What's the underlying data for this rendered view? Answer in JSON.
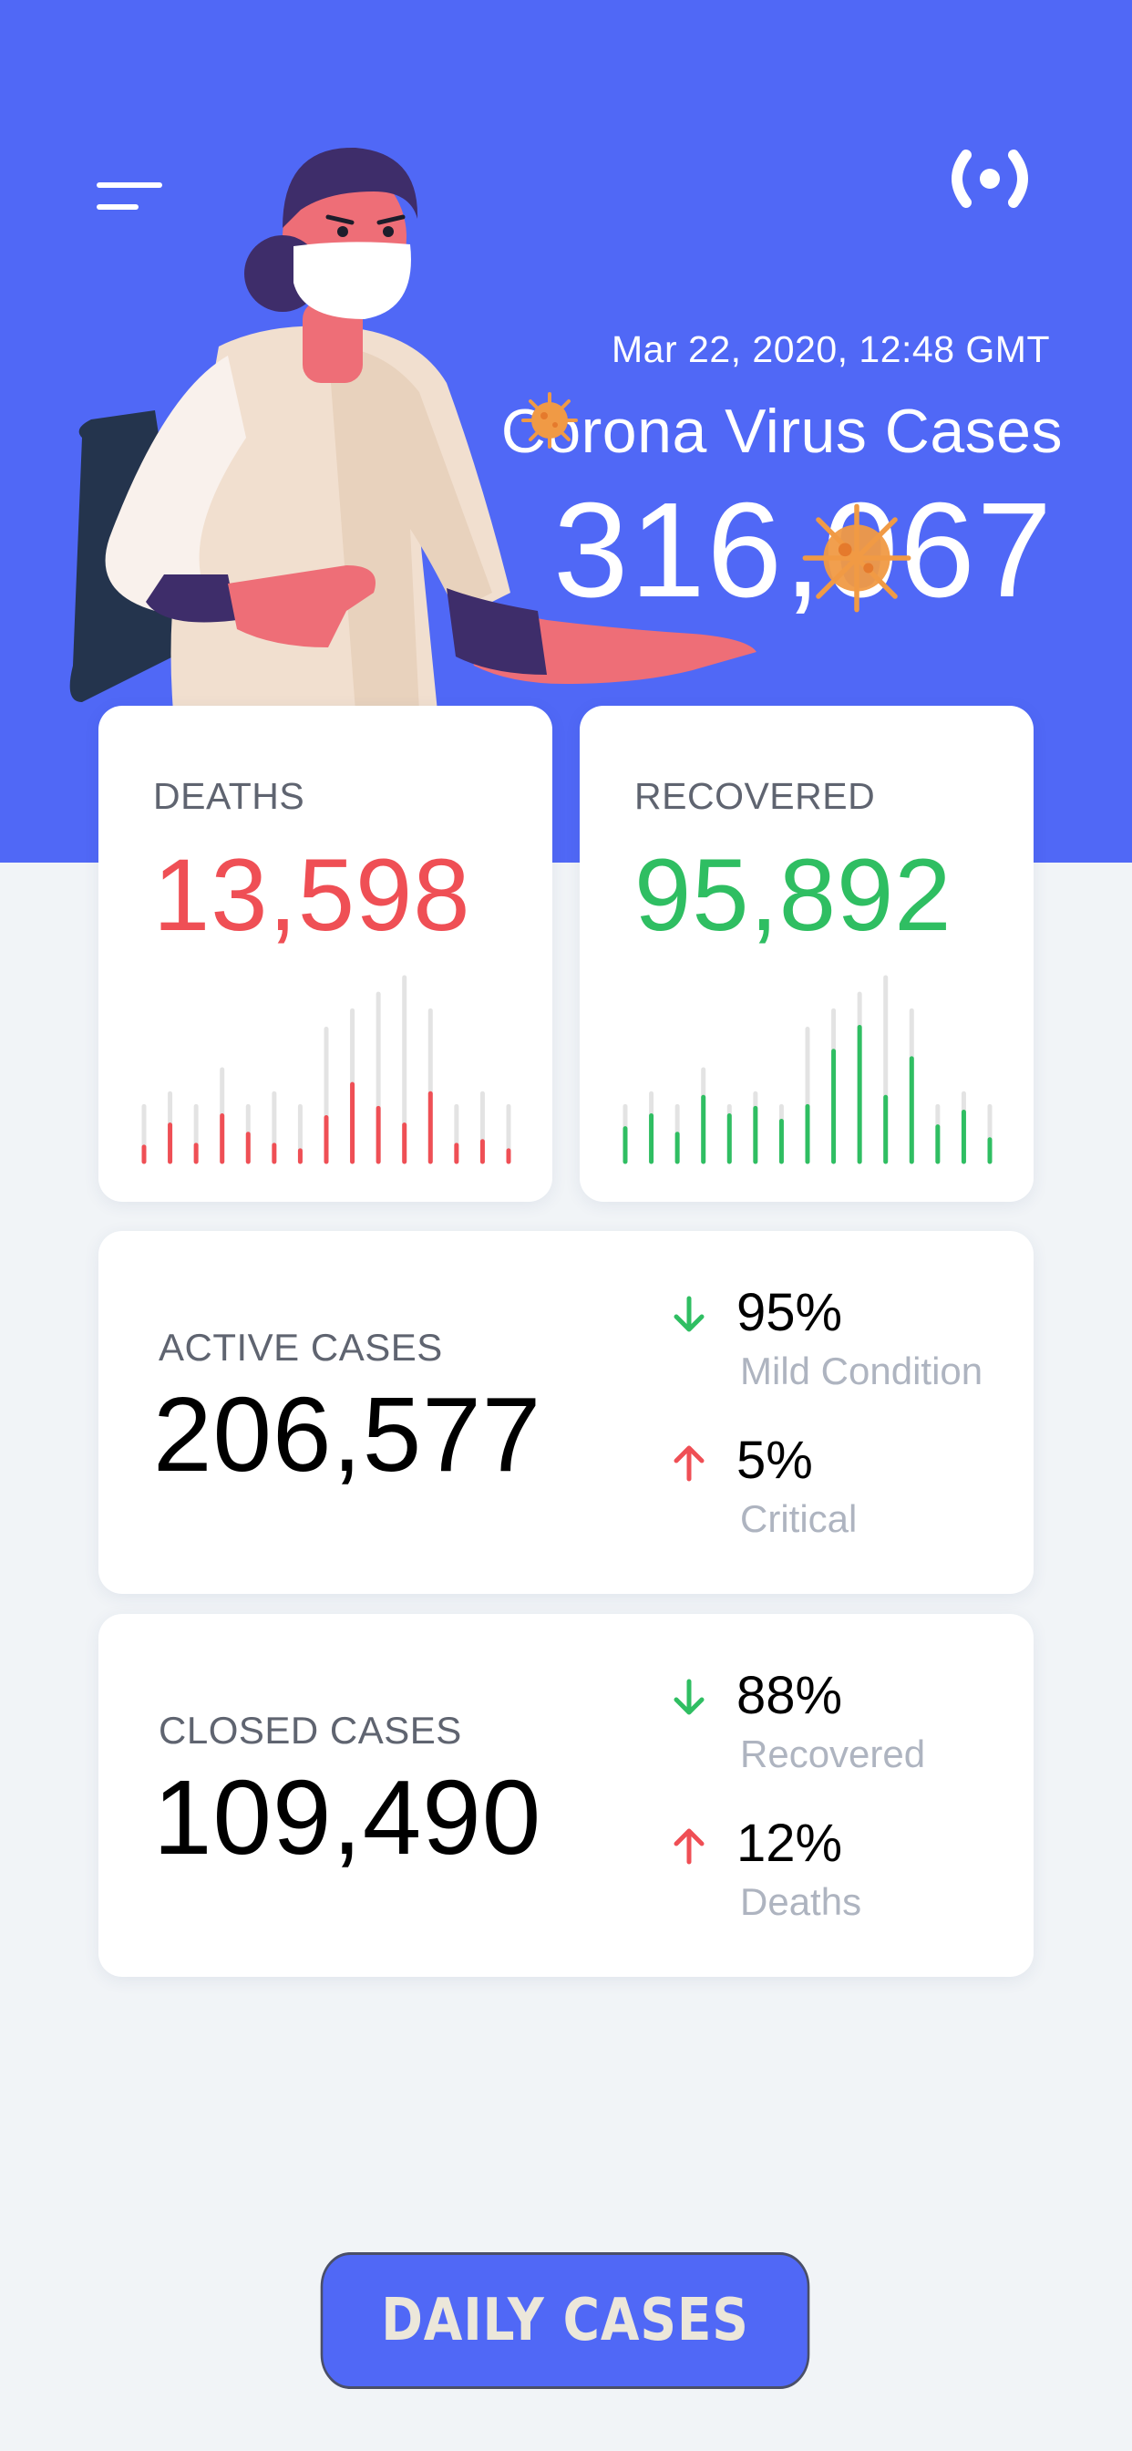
{
  "header": {
    "date": "Mar 22, 2020, 12:48 GMT",
    "title": "Corona Virus Cases",
    "total": "316,067"
  },
  "icons": {
    "menu": "menu-icon",
    "live": "live-broadcast-icon",
    "up": "arrow-up-icon",
    "down": "arrow-down-icon"
  },
  "colors": {
    "primary": "#5068f6",
    "deaths": "#ef4f55",
    "recovered": "#2fbe62",
    "background": "#f1f4f7",
    "bar_track": "#e3e3e3"
  },
  "deaths": {
    "label": "DEATHS",
    "value": "13,598",
    "chart": {
      "totals": [
        0.3,
        0.37,
        0.3,
        0.5,
        0.3,
        0.37,
        0.3,
        0.72,
        0.82,
        0.91,
        1.0,
        0.82,
        0.3,
        0.37,
        0.3
      ],
      "values": [
        0.08,
        0.2,
        0.09,
        0.25,
        0.15,
        0.09,
        0.06,
        0.24,
        0.42,
        0.29,
        0.2,
        0.37,
        0.09,
        0.11,
        0.06
      ]
    }
  },
  "recovered": {
    "label": "RECOVERED",
    "value": "95,892",
    "chart": {
      "totals": [
        0.3,
        0.37,
        0.3,
        0.5,
        0.3,
        0.37,
        0.3,
        0.72,
        0.82,
        0.91,
        1.0,
        0.82,
        0.3,
        0.37,
        0.3
      ],
      "values": [
        0.18,
        0.25,
        0.15,
        0.35,
        0.25,
        0.29,
        0.22,
        0.3,
        0.6,
        0.73,
        0.35,
        0.56,
        0.19,
        0.27,
        0.12
      ]
    }
  },
  "active": {
    "label": "ACTIVE CASES",
    "value": "206,577",
    "stats": [
      {
        "percent": "95%",
        "desc": "Mild Condition",
        "direction": "down"
      },
      {
        "percent": "5%",
        "desc": "Critical",
        "direction": "up"
      }
    ]
  },
  "closed": {
    "label": "CLOSED CASES",
    "value": "109,490",
    "stats": [
      {
        "percent": "88%",
        "desc": "Recovered",
        "direction": "down"
      },
      {
        "percent": "12%",
        "desc": "Deaths",
        "direction": "up"
      }
    ]
  },
  "daily_button": {
    "label": "DAILY CASES"
  }
}
